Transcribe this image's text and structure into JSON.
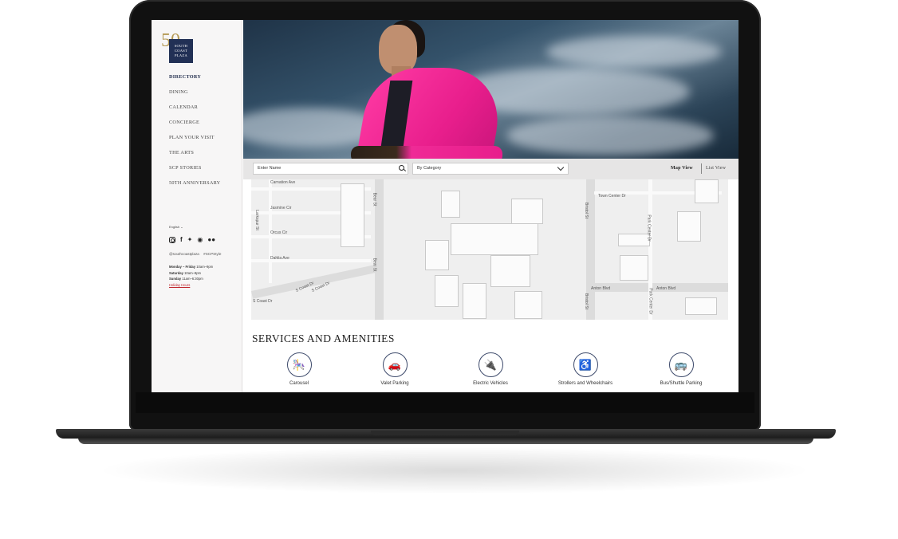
{
  "logo": {
    "numeral": "50",
    "lines": [
      "SOUTH",
      "COAST",
      "PLAZA"
    ]
  },
  "sidebar": {
    "nav": [
      {
        "label": "DIRECTORY",
        "active": true
      },
      {
        "label": "DINING"
      },
      {
        "label": "CALENDAR"
      },
      {
        "label": "CONCIERGE"
      },
      {
        "label": "PLAN YOUR VISIT"
      },
      {
        "label": "THE ARTS"
      },
      {
        "label": "SCP STORIES"
      },
      {
        "label": "50TH ANNIVERSARY"
      }
    ],
    "language": "English",
    "social_icons": [
      "instagram-icon",
      "facebook-icon",
      "twitter-icon",
      "weibo-icon",
      "wechat-icon"
    ],
    "handle": "@southcoastplaza",
    "hashtag": "#SCPStyle",
    "hours": [
      {
        "days": "Monday – Friday",
        "time": "10am–9pm"
      },
      {
        "days": "Saturday",
        "time": "10am–8pm"
      },
      {
        "days": "Sunday",
        "time": "11am–6:30pm"
      }
    ],
    "holiday_link": "Holiday Hours"
  },
  "search": {
    "name_placeholder": "Enter Name",
    "category_value": "By Category"
  },
  "view_toggle": {
    "map": "Map View",
    "list": "List View"
  },
  "map": {
    "streets": [
      "Carnation Ave",
      "Jasmine Cir",
      "Orcus Cir",
      "Dahlia Ave",
      "Larkspur St",
      "Bear St",
      "Bear St",
      "S Coast Dr",
      "S Coast Dr",
      "S Coast Dr",
      "Town Center Dr",
      "Bristol St",
      "Park Center Dr",
      "Anton Blvd",
      "Anton Blvd",
      "Bristol St",
      "Park Center Dr"
    ]
  },
  "services": {
    "title": "SERVICES AND AMENITIES",
    "items": [
      {
        "label": "Carousel",
        "icon": "carousel-icon",
        "glyph": "🎠"
      },
      {
        "label": "Valet Parking",
        "icon": "valet-parking-icon",
        "glyph": "🚗"
      },
      {
        "label": "Electric Vehicles",
        "icon": "ev-charger-icon",
        "glyph": "🔌"
      },
      {
        "label": "Strollers and Wheelchairs",
        "icon": "wheelchair-icon",
        "glyph": "♿"
      },
      {
        "label": "Bus/Shuttle Parking",
        "icon": "shuttle-icon",
        "glyph": "🚌"
      }
    ]
  },
  "colors": {
    "navy": "#213055",
    "gold": "#b59a55",
    "accent_pink": "#e81e8c",
    "holiday_red": "#c0262d"
  }
}
